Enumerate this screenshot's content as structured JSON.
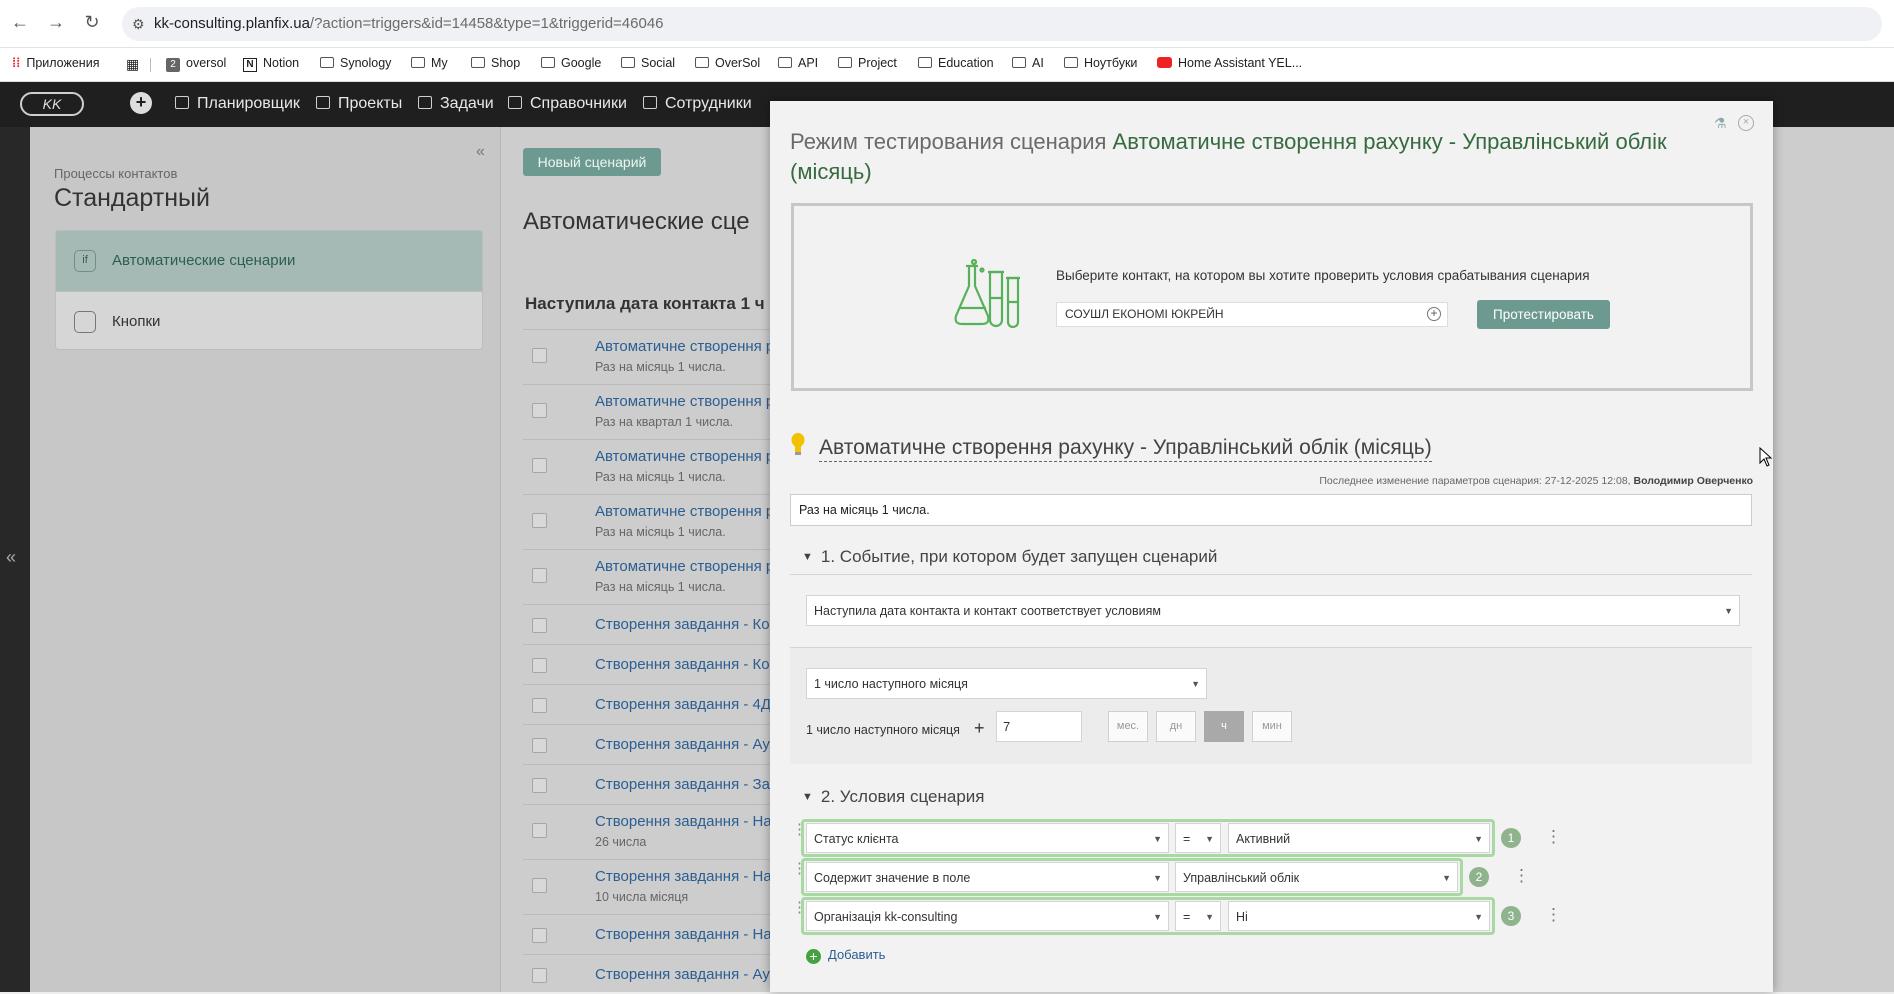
{
  "browser": {
    "url_host": "kk-consulting.planfix.ua",
    "url_path": "/?action=triggers&id=14458&type=1&triggerid=46046",
    "bookmarks": [
      {
        "label": "Приложения"
      },
      {
        "label": "oversol"
      },
      {
        "label": "Notion"
      },
      {
        "label": "Synology"
      },
      {
        "label": "My"
      },
      {
        "label": "Shop"
      },
      {
        "label": "Google"
      },
      {
        "label": "Social"
      },
      {
        "label": "OverSol"
      },
      {
        "label": "API"
      },
      {
        "label": "Project"
      },
      {
        "label": "Education"
      },
      {
        "label": "AI"
      },
      {
        "label": "Ноутбуки"
      },
      {
        "label": "Home Assistant YEL..."
      }
    ]
  },
  "app": {
    "logo": "KK",
    "menu": [
      {
        "label": "Планировщик"
      },
      {
        "label": "Проекты"
      },
      {
        "label": "Задачи"
      },
      {
        "label": "Справочники"
      },
      {
        "label": "Сотрудники"
      }
    ]
  },
  "sidebar": {
    "subtitle": "Процессы контактов",
    "title": "Стандартный",
    "items": [
      {
        "label": "Автоматические сценарии",
        "active": true
      },
      {
        "label": "Кнопки",
        "active": false
      }
    ]
  },
  "list": {
    "new_button": "Новый сценарий",
    "heading": "Автоматические сце",
    "group_heading": "Наступила дата контакта 1 ч",
    "rows": [
      {
        "title": "Автоматичне створення р",
        "subtitle": "Раз на місяць 1 числа."
      },
      {
        "title": "Автоматичне створення р",
        "subtitle": "Раз на квартал 1 числа."
      },
      {
        "title": "Автоматичне створення р",
        "subtitle": "Раз на місяць 1 числа."
      },
      {
        "title": "Автоматичне створення р",
        "subtitle": "Раз на місяць 1 числа."
      },
      {
        "title": "Автоматичне створення р",
        "subtitle": "Раз на місяць 1 числа."
      },
      {
        "title": "Створення завдання - Ко",
        "subtitle": ""
      },
      {
        "title": "Створення завдання - Ко",
        "subtitle": ""
      },
      {
        "title": "Створення завдання - 4Д",
        "subtitle": ""
      },
      {
        "title": "Створення завдання - Ау",
        "subtitle": ""
      },
      {
        "title": "Створення завдання - Зак",
        "subtitle": ""
      },
      {
        "title": "Створення завдання - На",
        "subtitle": "26 числа"
      },
      {
        "title": "Створення завдання - На",
        "subtitle": "10 числа місяця"
      },
      {
        "title": "Створення завдання - На",
        "subtitle": ""
      },
      {
        "title": "Створення завдання - Ау",
        "subtitle": ""
      }
    ]
  },
  "modal": {
    "title_prefix": "Режим тестирования сценария",
    "title_name": "Автоматичне створення рахунку - Управлінський облік (місяць)",
    "test": {
      "prompt": "Выберите контакт, на котором вы хотите проверить условия срабатывания сценария",
      "contact_value": "СОУШЛ ЕКОНОМІ ЮКРЕЙН",
      "button": "Протестировать"
    },
    "scenario_title": "Автоматичне створення рахунку - Управлінський облік (місяць)",
    "meta_label": "Последнее изменение параметров сценария: 27-12-2025 12:08,",
    "meta_author": "Володимир Оверченко",
    "description": "Раз на місяць 1 числа.",
    "section1": {
      "heading": "1. Событие, при котором будет запущен сценарий",
      "event": "Наступила дата контакта и контакт соответствует условиям",
      "date_field": "1 число наступного місяця",
      "offset_label": "1 число наступного місяця",
      "offset_sign": "+",
      "offset_value": "7",
      "units": [
        {
          "label": "мес.",
          "active": false
        },
        {
          "label": "дн",
          "active": false
        },
        {
          "label": "ч",
          "active": true
        },
        {
          "label": "мин",
          "active": false
        }
      ]
    },
    "section2": {
      "heading": "2. Условия сценария",
      "conditions": [
        {
          "field": "Статус клієнта",
          "operator": "=",
          "value": "Активний",
          "index": "1"
        },
        {
          "field": "Содержит значение в поле",
          "operator": "",
          "value": "Управлінський облік",
          "index": "2"
        },
        {
          "field": "Організація kk-consulting",
          "operator": "=",
          "value": "Ні",
          "index": "3"
        }
      ],
      "add_label": "Добавить"
    }
  },
  "colors": {
    "accent": "#6d9a90",
    "title_green": "#356b3e",
    "condition_border": "#a9d9a3",
    "link": "#2b5e92"
  }
}
